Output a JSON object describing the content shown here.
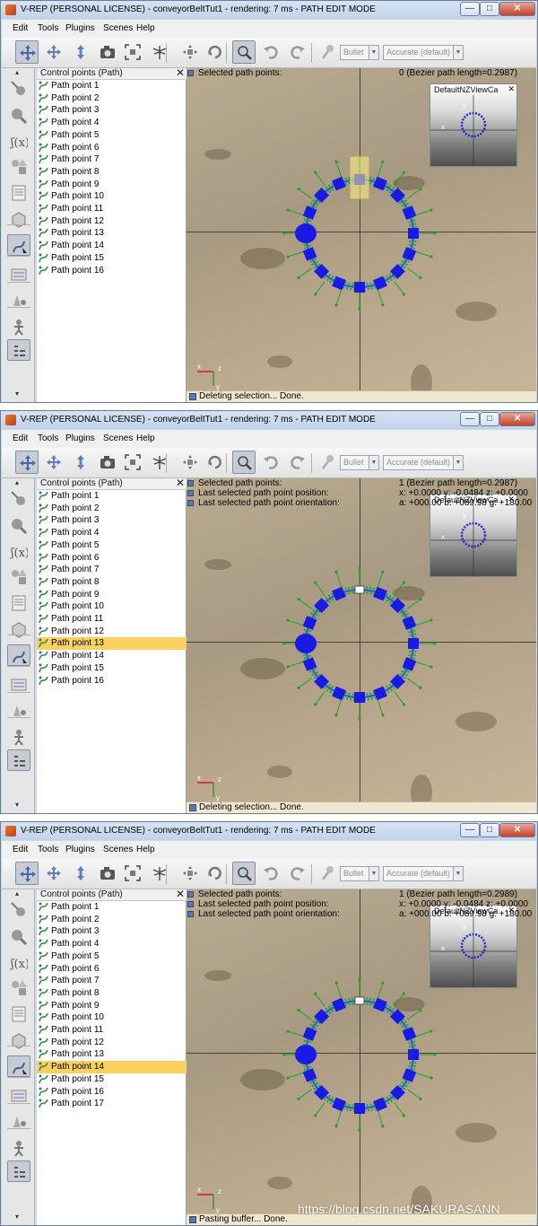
{
  "window": {
    "title": "V-REP (PERSONAL LICENSE) - conveyorBeltTut1 - rendering: 7 ms - PATH EDIT MODE",
    "min_label": "—",
    "max_label": "□",
    "close_label": "✕"
  },
  "menu": [
    "Edit",
    "Tools",
    "Plugins",
    "Scenes",
    "Help"
  ],
  "toolbar": {
    "buttons": [
      "move-view-icon",
      "rotate-view-icon",
      "shift-view-icon",
      "camera-icon",
      "fit-view-icon",
      "dragonfly-icon",
      "object-shift-icon",
      "object-rotate-icon",
      "click-select-icon",
      "undo-icon",
      "redo-icon",
      "assemble-icon"
    ],
    "engine": "Bullet",
    "accuracy": "Accurate (default)"
  },
  "left_toolbar": [
    "simulation-settings-icon",
    "selection-icon",
    "script-icon",
    "shapes-icon",
    "page-icon",
    "model-browser-icon",
    "path-edit-icon",
    "layers-icon",
    "collections-icon",
    "user-settings-icon",
    "hierarchy-icon"
  ],
  "hierarchy_title": "Control points (Path)",
  "hierarchy_close": "✕",
  "minimap_title": "DefaultNZViewCa",
  "minimap_close": "✕",
  "axes": {
    "x": "x",
    "y": "y",
    "z": "z"
  },
  "panels": [
    {
      "items": [
        "Path point 1",
        "Path point 2",
        "Path point 3",
        "Path point 4",
        "Path point 5",
        "Path point 6",
        "Path point 7",
        "Path point 8",
        "Path point 9",
        "Path point 10",
        "Path point 11",
        "Path point 12",
        "Path point 13",
        "Path point 14",
        "Path point 15",
        "Path point 16"
      ],
      "selected": -1,
      "info_rows": [
        {
          "label": "Selected path points:",
          "value": "0 (Bezier path length=0.2987)"
        }
      ],
      "status": "Deleting selection... Done.",
      "highlight_top_point": true
    },
    {
      "items": [
        "Path point 1",
        "Path point 2",
        "Path point 3",
        "Path point 4",
        "Path point 5",
        "Path point 6",
        "Path point 7",
        "Path point 8",
        "Path point 9",
        "Path point 10",
        "Path point 11",
        "Path point 12",
        "Path point 13",
        "Path point 14",
        "Path point 15",
        "Path point 16"
      ],
      "selected": 12,
      "info_rows": [
        {
          "label": "Selected path points:",
          "value": "1 (Bezier path length=0.2987)"
        },
        {
          "label": "Last selected path point position:",
          "value": "x: +0.0000    y: -0.0484    z: +0.0000"
        },
        {
          "label": "Last selected path point orientation:",
          "value": "a: +000.00    b: +089.98    g: +180.00"
        }
      ],
      "status": "Deleting selection... Done.",
      "highlight_top_point": false
    },
    {
      "items": [
        "Path point 1",
        "Path point 2",
        "Path point 3",
        "Path point 4",
        "Path point 5",
        "Path point 6",
        "Path point 7",
        "Path point 8",
        "Path point 9",
        "Path point 10",
        "Path point 11",
        "Path point 12",
        "Path point 13",
        "Path point 14",
        "Path point 15",
        "Path point 16",
        "Path point 17"
      ],
      "selected": 13,
      "info_rows": [
        {
          "label": "Selected path points:",
          "value": "1 (Bezier path length=0.2989)"
        },
        {
          "label": "Last selected path point position:",
          "value": "x: +0.0000    y: -0.0484    z: +0.0000"
        },
        {
          "label": "Last selected path point orientation:",
          "value": "a: +000.00    b: +089.98    g: +180.00"
        }
      ],
      "status": "Pasting buffer... Done.",
      "highlight_top_point": false
    }
  ],
  "watermark": "https://blog.csdn.net/SAKURASANN",
  "colors": {
    "path_point": "#1a1ae6",
    "direction_arrow": "#1fa31f",
    "selected_row": "#fbd160",
    "title_bar": "#c9d9ee"
  }
}
